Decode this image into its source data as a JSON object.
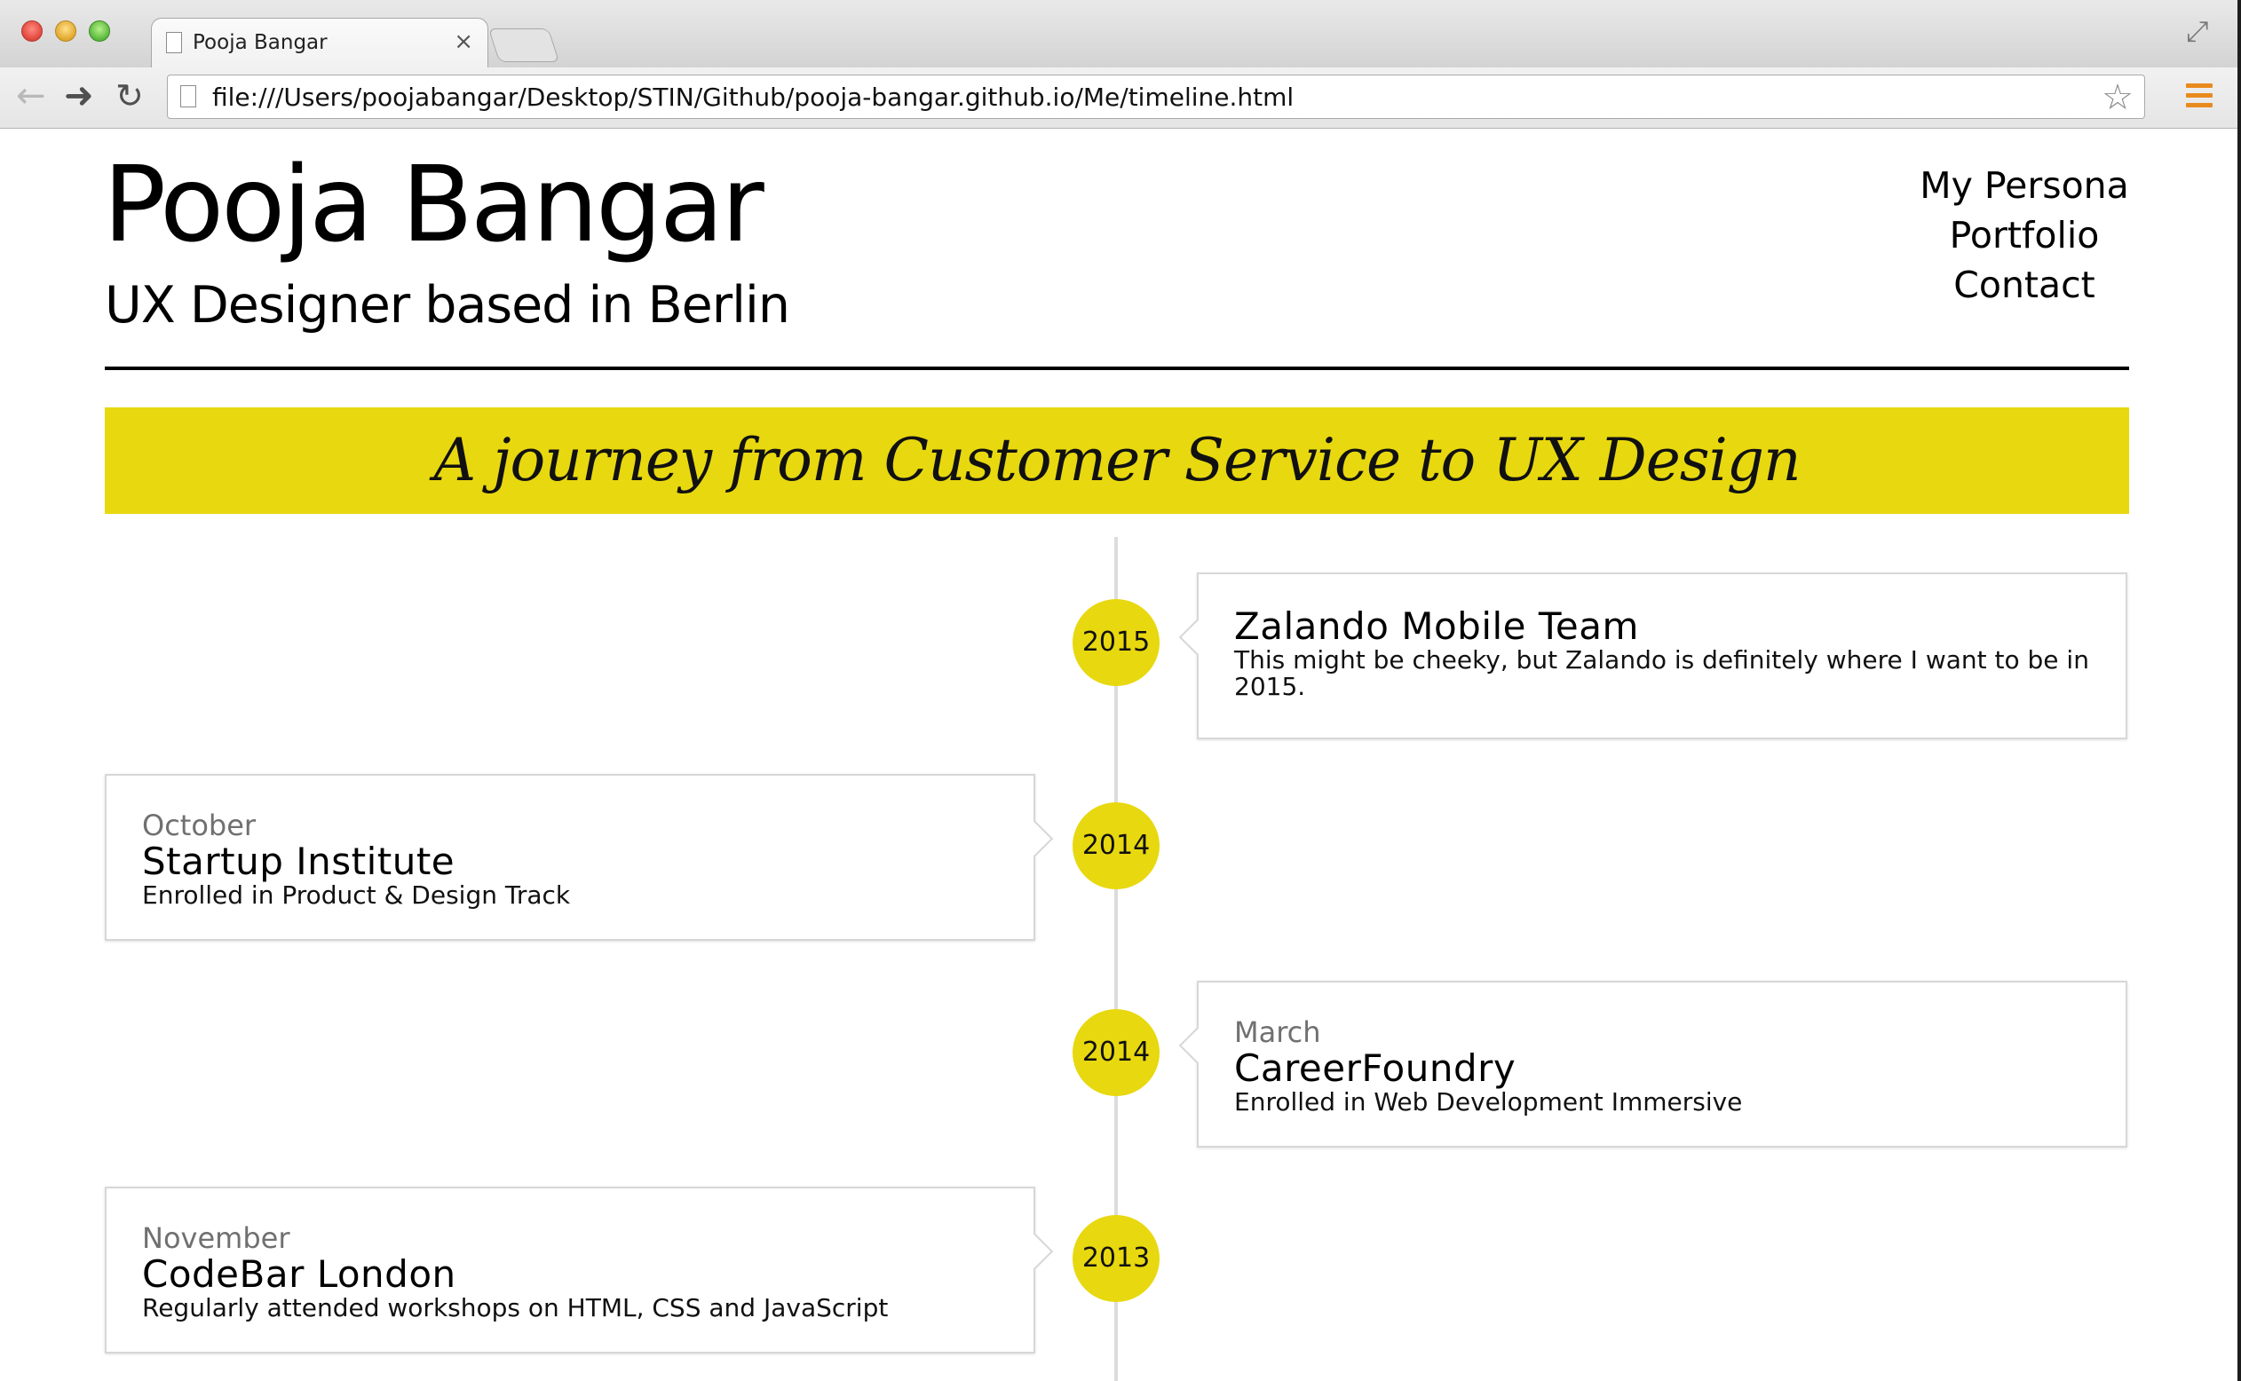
{
  "browser": {
    "tab_title": "Pooja Bangar",
    "tab_close": "×",
    "url": "file:///Users/poojabangar/Desktop/STIN/Github/pooja-bangar.github.io/Me/timeline.html",
    "back_glyph": "←",
    "forward_glyph": "➜",
    "reload_glyph": "↻",
    "star_glyph": "☆",
    "fullscreen_glyph": "⤢"
  },
  "header": {
    "name": "Pooja Bangar",
    "tagline": "UX Designer based in Berlin",
    "nav": [
      "My Persona",
      "Portfolio",
      "Contact"
    ]
  },
  "banner": {
    "title": "A journey from Customer Service to UX Design"
  },
  "accent_color": "#e8d80f",
  "timeline": [
    {
      "year": "2015",
      "month": "",
      "title": "Zalando Mobile Team",
      "description": "This might be cheeky, but Zalando is definitely where I want to be in 2015."
    },
    {
      "year": "2014",
      "month": "October",
      "title": "Startup Institute",
      "description": "Enrolled in Product & Design Track"
    },
    {
      "year": "2014",
      "month": "March",
      "title": "CareerFoundry",
      "description": "Enrolled in Web Development Immersive"
    },
    {
      "year": "2013",
      "month": "November",
      "title": "CodeBar London",
      "description": "Regularly attended workshops on HTML, CSS and JavaScript"
    }
  ]
}
